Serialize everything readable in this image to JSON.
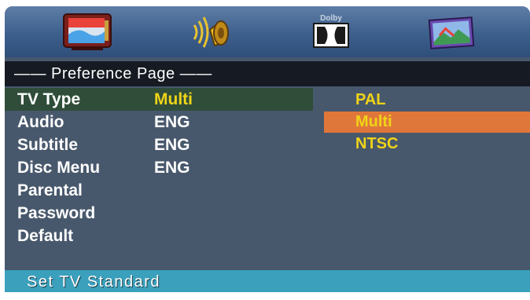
{
  "tabs": [
    {
      "name": "tv-setup",
      "icon": "tv-icon"
    },
    {
      "name": "audio-setup",
      "icon": "speaker-icon"
    },
    {
      "name": "dolby-setup",
      "icon": "dolby-icon",
      "text": "Dolby"
    },
    {
      "name": "video-setup",
      "icon": "picture-icon"
    }
  ],
  "page_title": "——  Preference Page  ——",
  "menu_items": [
    {
      "label": "TV Type",
      "value": "Multi"
    },
    {
      "label": "Audio",
      "value": "ENG"
    },
    {
      "label": "Subtitle",
      "value": "ENG"
    },
    {
      "label": "Disc Menu",
      "value": "ENG"
    },
    {
      "label": "Parental",
      "value": ""
    },
    {
      "label": "Password",
      "value": ""
    },
    {
      "label": "Default",
      "value": ""
    }
  ],
  "selected_item": "TV Type",
  "options": [
    "PAL",
    "Multi",
    "NTSC"
  ],
  "selected_option": "Multi",
  "status_text": "Set TV Standard",
  "colors": {
    "background": "#48586c",
    "highlight_row": "#2f4d39",
    "option_highlight": "#e0773a",
    "value_yellow": "#f0d418",
    "status_bar": "#3aa0bc"
  }
}
